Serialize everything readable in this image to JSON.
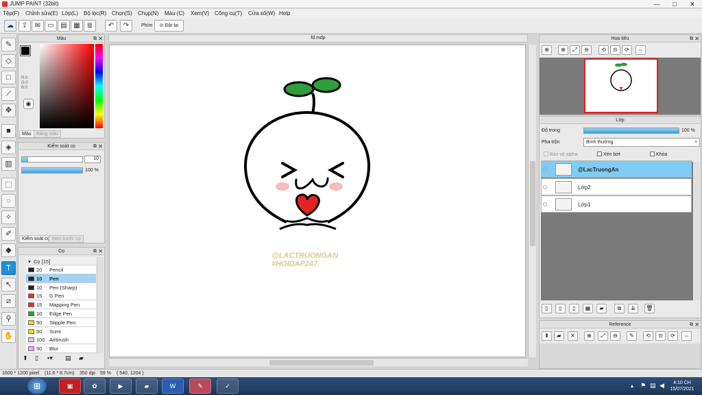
{
  "window": {
    "title": "JUMP PAINT (32bit)"
  },
  "menu": [
    "Tệp(F)",
    "Chỉnh sửa(E)",
    "Lớp(L)",
    "Bộ lọc(R)",
    "Chọn(S)",
    "Chụp(N)",
    "Màu (C)",
    "Xem(V)",
    "Công cụ(T)",
    "Cửa sổ(W)",
    "Help"
  ],
  "toolbar": {
    "label": "Phím",
    "reset_label": "Đặt lại"
  },
  "color_panel": {
    "title": "Màu",
    "values": [
      "R:0",
      "G:0",
      "B:0"
    ],
    "tabs": [
      "Màu",
      "Bảng màu"
    ],
    "hue_color": "#ff0000"
  },
  "brush_control": {
    "title": "Kiểm soát cọ",
    "size_value": "10",
    "opacity_value": "100 %",
    "size_fraction": 0.1,
    "opacity_fraction": 1.0,
    "tabs": [
      "Kiểm soát cọ",
      "Xem trước cọ"
    ]
  },
  "brush_panel": {
    "title": "Cọ",
    "group": "Cọ [15]",
    "brushes": [
      {
        "size": "20",
        "name": "Pencil",
        "color": "#222222"
      },
      {
        "size": "10",
        "name": "Pen",
        "color": "#222222"
      },
      {
        "size": "10",
        "name": "Pen (Sharp)",
        "color": "#222222"
      },
      {
        "size": "15",
        "name": "G Pen",
        "color": "#e53030"
      },
      {
        "size": "15",
        "name": "Mapping Pen",
        "color": "#e53030"
      },
      {
        "size": "10",
        "name": "Edge Pen",
        "color": "#22aa22"
      },
      {
        "size": "50",
        "name": "Stipple Pen",
        "color": "#e8e000"
      },
      {
        "size": "50",
        "name": "Sumi",
        "color": "#e8e000"
      },
      {
        "size": "100",
        "name": "Airbrush",
        "color": "#d0d0d0"
      },
      {
        "size": "50",
        "name": "Blur",
        "color": "#f4a8f0"
      }
    ],
    "selected_index": 1
  },
  "document": {
    "tab_title": "fd.mdp"
  },
  "artwork": {
    "watermark_line1": "@LACTRUONGAN",
    "watermark_line2": "#HOIDAP247"
  },
  "navigator": {
    "title": "Hoa tiêu"
  },
  "layers_panel": {
    "title": "Lớp",
    "opacity_label": "Độ trong",
    "opacity_value": "100 %",
    "opacity_fraction": 1.0,
    "blend_label": "Pha trộn",
    "blend_value": "Bình thường",
    "checkbox_alpha": "Bảo vệ alpha",
    "checkbox_clip": "Xén bớt",
    "checkbox_lock": "Khóa",
    "layers": [
      "@LacTruongAn",
      "Lớp2",
      "Lớp1"
    ],
    "selected_index": 0
  },
  "reference_panel": {
    "title": "Reference"
  },
  "status": {
    "size": "1600 * 1200 pixel",
    "physical": "(11.6 * 8.7cm)",
    "dpi": "350 dpi",
    "zoom": "59 %",
    "coords": "( 540, 1204 )"
  },
  "taskbar": {
    "time": "4:10 CH",
    "date": "15/07/2021"
  }
}
